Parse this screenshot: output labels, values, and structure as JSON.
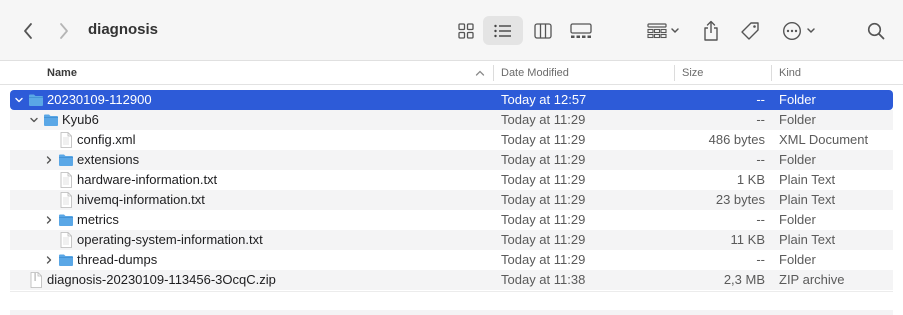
{
  "window": {
    "title": "diagnosis"
  },
  "toolbar": {
    "back_icon": "chevron-left-icon",
    "forward_icon": "chevron-right-icon",
    "view_icons": "grid-view-icon",
    "view_list": "list-view-icon",
    "view_columns": "column-view-icon",
    "view_gallery": "gallery-view-icon",
    "group": "group-by-icon",
    "share": "share-icon",
    "tags": "tag-icon",
    "more": "ellipsis-circle-icon",
    "search": "search-icon"
  },
  "columns": {
    "name": "Name",
    "date": "Date Modified",
    "size": "Size",
    "kind": "Kind"
  },
  "colors": {
    "selection": "#2d5bd8",
    "folder": "#5aa7e6"
  },
  "rows": [
    {
      "name": "20230109-112900",
      "date": "Today at 12:57",
      "size": "--",
      "kind": "Folder",
      "type": "folder",
      "indent": 0,
      "disclosure": "open",
      "selected": true
    },
    {
      "name": "Kyub6",
      "date": "Today at 11:29",
      "size": "--",
      "kind": "Folder",
      "type": "folder",
      "indent": 1,
      "disclosure": "open",
      "selected": false
    },
    {
      "name": "config.xml",
      "date": "Today at 11:29",
      "size": "486 bytes",
      "kind": "XML Document",
      "type": "doc",
      "indent": 2,
      "disclosure": "none",
      "selected": false
    },
    {
      "name": "extensions",
      "date": "Today at 11:29",
      "size": "--",
      "kind": "Folder",
      "type": "folder",
      "indent": 2,
      "disclosure": "closed",
      "selected": false
    },
    {
      "name": "hardware-information.txt",
      "date": "Today at 11:29",
      "size": "1 KB",
      "kind": "Plain Text",
      "type": "doc",
      "indent": 2,
      "disclosure": "none",
      "selected": false
    },
    {
      "name": "hivemq-information.txt",
      "date": "Today at 11:29",
      "size": "23 bytes",
      "kind": "Plain Text",
      "type": "doc",
      "indent": 2,
      "disclosure": "none",
      "selected": false
    },
    {
      "name": "metrics",
      "date": "Today at 11:29",
      "size": "--",
      "kind": "Folder",
      "type": "folder",
      "indent": 2,
      "disclosure": "closed",
      "selected": false
    },
    {
      "name": "operating-system-information.txt",
      "date": "Today at 11:29",
      "size": "11 KB",
      "kind": "Plain Text",
      "type": "doc",
      "indent": 2,
      "disclosure": "none",
      "selected": false
    },
    {
      "name": "thread-dumps",
      "date": "Today at 11:29",
      "size": "--",
      "kind": "Folder",
      "type": "folder",
      "indent": 2,
      "disclosure": "closed",
      "selected": false
    },
    {
      "name": "diagnosis-20230109-113456-3OcqC.zip",
      "date": "Today at 11:38",
      "size": "2,3 MB",
      "kind": "ZIP archive",
      "type": "zip",
      "indent": 0,
      "disclosure": "none",
      "selected": false
    }
  ]
}
